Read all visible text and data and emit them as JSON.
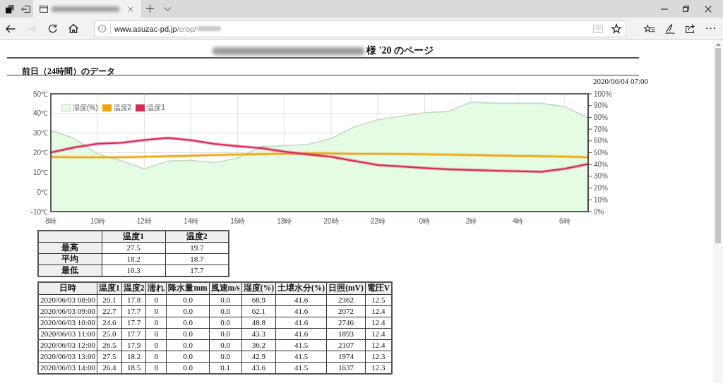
{
  "browser": {
    "tabs": [
      {
        "selected": true
      }
    ],
    "nav_buttons": [
      {
        "kind": "back",
        "disabled": false
      },
      {
        "kind": "forward",
        "disabled": true
      },
      {
        "kind": "refresh",
        "disabled": false
      },
      {
        "kind": "home",
        "disabled": false
      }
    ],
    "address": {
      "host": "www.asuzac-pd.jp",
      "path": "/crop/"
    },
    "address_buttons": [
      {
        "kind": "reading-view",
        "disabled": true
      },
      {
        "kind": "favorite",
        "disabled": false
      }
    ]
  },
  "page": {
    "title": "様 '20 のページ",
    "section_title": "前日（24時間）のデータ"
  },
  "chart": {
    "timestamp": "2020/06/04 07:00",
    "chart_data": {
      "type": "line",
      "x": [
        "2020-06-03T08:00",
        "2020-06-03T09:00",
        "2020-06-03T10:00",
        "2020-06-03T11:00",
        "2020-06-03T12:00",
        "2020-06-03T13:00",
        "2020-06-03T14:00",
        "2020-06-03T15:00",
        "2020-06-03T16:00",
        "2020-06-03T17:00",
        "2020-06-03T18:00",
        "2020-06-03T19:00",
        "2020-06-03T20:00",
        "2020-06-03T21:00",
        "2020-06-03T22:00",
        "2020-06-03T23:00",
        "2020-06-04T00:00",
        "2020-06-04T01:00",
        "2020-06-04T02:00",
        "2020-06-04T03:00",
        "2020-06-04T04:00",
        "2020-06-04T05:00",
        "2020-06-04T06:00",
        "2020-06-04T07:00"
      ],
      "xlim": [
        "2020-06-03T08:00",
        "2020-06-04T07:00"
      ],
      "xticks": [
        {
          "value": "2020-06-03T08:00",
          "label": "8時"
        },
        {
          "value": "2020-06-03T10:00",
          "label": "10時"
        },
        {
          "value": "2020-06-03T12:00",
          "label": "12時"
        },
        {
          "value": "2020-06-03T14:00",
          "label": "14時"
        },
        {
          "value": "2020-06-03T16:00",
          "label": "16時"
        },
        {
          "value": "2020-06-03T18:00",
          "label": "18時"
        },
        {
          "value": "2020-06-03T20:00",
          "label": "20時"
        },
        {
          "value": "2020-06-03T22:00",
          "label": "22時"
        },
        {
          "value": "2020-06-04T00:00",
          "label": "0時"
        },
        {
          "value": "2020-06-04T02:00",
          "label": "2時"
        },
        {
          "value": "2020-06-04T04:00",
          "label": "4時"
        },
        {
          "value": "2020-06-04T06:00",
          "label": "6時"
        }
      ],
      "ylim": [
        -10,
        50
      ],
      "yticks": [
        {
          "value": -10,
          "label": "-10℃"
        },
        {
          "value": 0,
          "label": "0℃"
        },
        {
          "value": 10,
          "label": "10℃"
        },
        {
          "value": 20,
          "label": "20℃"
        },
        {
          "value": 30,
          "label": "30℃"
        },
        {
          "value": 40,
          "label": "40℃"
        },
        {
          "value": 50,
          "label": "50℃"
        }
      ],
      "y2lim": [
        0,
        100
      ],
      "y2ticks": [
        {
          "value": 0,
          "label": "0%"
        },
        {
          "value": 10,
          "label": "10%"
        },
        {
          "value": 20,
          "label": "20%"
        },
        {
          "value": 30,
          "label": "30%"
        },
        {
          "value": 40,
          "label": "40%"
        },
        {
          "value": 50,
          "label": "50%"
        },
        {
          "value": 60,
          "label": "60%"
        },
        {
          "value": 70,
          "label": "70%"
        },
        {
          "value": 80,
          "label": "80%"
        },
        {
          "value": 90,
          "label": "90%"
        },
        {
          "value": 100,
          "label": "100%"
        }
      ],
      "grid": true,
      "legend": "upper left",
      "series": [
        {
          "name": "湿度(%)",
          "color": "#e4fbe4",
          "type": "area",
          "axis": "y2",
          "values": [
            68.9,
            62.1,
            48.8,
            43.3,
            36.2,
            42.9,
            43.6,
            41.5,
            45.5,
            55,
            56,
            57,
            62,
            72,
            78,
            81,
            84,
            85,
            93,
            92,
            92,
            92,
            89,
            79.5
          ]
        },
        {
          "name": "温度2",
          "color": "#f0a30a",
          "type": "line",
          "values": [
            17.8,
            17.7,
            17.7,
            17.7,
            17.9,
            18.2,
            18.5,
            18.8,
            19.1,
            19.3,
            19.5,
            19.7,
            19.6,
            19.5,
            19.5,
            19.4,
            19.2,
            19.0,
            18.8,
            18.6,
            18.4,
            18.2,
            18.0,
            17.7
          ]
        },
        {
          "name": "温度1",
          "color": "#dc2857",
          "type": "line",
          "values": [
            20.1,
            22.7,
            24.6,
            25.0,
            26.5,
            27.5,
            26.4,
            24.5,
            23.3,
            22.3,
            20.5,
            19.1,
            17.9,
            15.8,
            13.7,
            13.0,
            12.2,
            11.6,
            11.2,
            10.8,
            10.6,
            10.3,
            11.8,
            14.3
          ]
        }
      ]
    }
  },
  "summary_table": {
    "columns": [
      "温度1",
      "温度2"
    ],
    "rows": [
      {
        "label": "最高",
        "values": [
          "27.5",
          "19.7"
        ]
      },
      {
        "label": "平均",
        "values": [
          "18.2",
          "18.7"
        ]
      },
      {
        "label": "最低",
        "values": [
          "10.3",
          "17.7"
        ]
      }
    ]
  },
  "data_table": {
    "columns": [
      "日時",
      "温度1",
      "温度2",
      "濡れ",
      "降水量mm",
      "風速m/s",
      "湿度(%)",
      "土壌水分(%)",
      "日照(mV)",
      "電圧V"
    ],
    "rows": [
      [
        "2020/06/03 08:00",
        "20.1",
        "17.8",
        "0",
        "0.0",
        "0.0",
        "68.9",
        "41.6",
        "2362",
        "12.5"
      ],
      [
        "2020/06/03 09:00",
        "22.7",
        "17.7",
        "0",
        "0.0",
        "0.0",
        "62.1",
        "41.6",
        "2072",
        "12.4"
      ],
      [
        "2020/06/03 10:00",
        "24.6",
        "17.7",
        "0",
        "0.0",
        "0.0",
        "48.8",
        "41.6",
        "2746",
        "12.4"
      ],
      [
        "2020/06/03 11:00",
        "25.0",
        "17.7",
        "0",
        "0.0",
        "0.0",
        "43.3",
        "41.6",
        "1893",
        "12.4"
      ],
      [
        "2020/06/03 12:00",
        "26.5",
        "17.9",
        "0",
        "0.0",
        "0.0",
        "36.2",
        "41.5",
        "2107",
        "12.4"
      ],
      [
        "2020/06/03 13:00",
        "27.5",
        "18.2",
        "0",
        "0.0",
        "0.0",
        "42.9",
        "41.5",
        "1974",
        "12.3"
      ],
      [
        "2020/06/03 14:00",
        "26.4",
        "18.5",
        "0",
        "0.0",
        "0.1",
        "43.6",
        "41.5",
        "1637",
        "12.3"
      ]
    ]
  }
}
